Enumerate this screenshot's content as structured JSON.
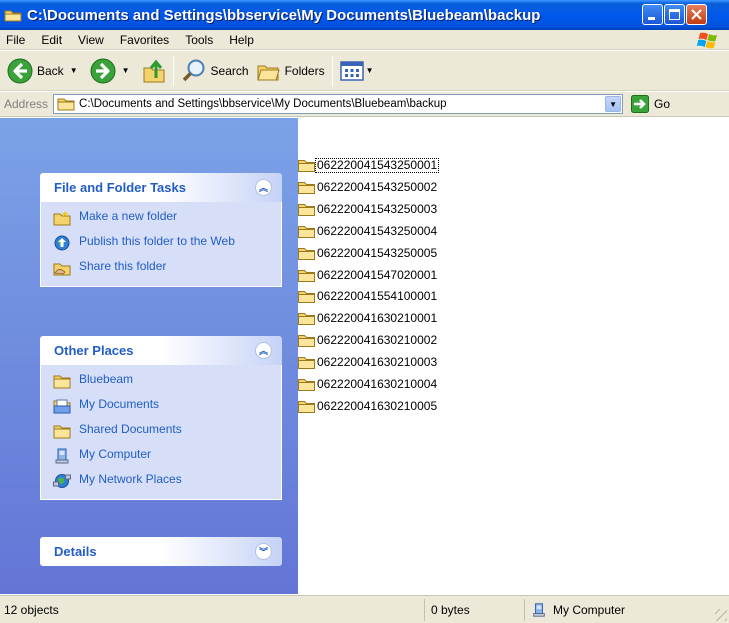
{
  "window": {
    "title": "C:\\Documents and Settings\\bbservice\\My Documents\\Bluebeam\\backup"
  },
  "menu": [
    "File",
    "Edit",
    "View",
    "Favorites",
    "Tools",
    "Help"
  ],
  "toolbar": {
    "back_label": "Back",
    "search_label": "Search",
    "folders_label": "Folders"
  },
  "address": {
    "label": "Address",
    "value": "C:\\Documents and Settings\\bbservice\\My Documents\\Bluebeam\\backup",
    "go_label": "Go"
  },
  "tasks": {
    "file_folder": {
      "title": "File and Folder Tasks",
      "items": [
        {
          "label": "Make a new folder",
          "icon": "new-folder-icon"
        },
        {
          "label": "Publish this folder to the Web",
          "icon": "publish-web-icon"
        },
        {
          "label": "Share this folder",
          "icon": "share-folder-icon"
        }
      ]
    },
    "other_places": {
      "title": "Other Places",
      "items": [
        {
          "label": "Bluebeam",
          "icon": "folder-icon"
        },
        {
          "label": "My Documents",
          "icon": "my-documents-icon"
        },
        {
          "label": "Shared Documents",
          "icon": "folder-icon"
        },
        {
          "label": "My Computer",
          "icon": "my-computer-icon"
        },
        {
          "label": "My Network Places",
          "icon": "network-places-icon"
        }
      ]
    },
    "details": {
      "title": "Details"
    }
  },
  "files": [
    "062220041543250001",
    "062220041543250002",
    "062220041543250003",
    "062220041543250004",
    "062220041543250005",
    "062220041547020001",
    "062220041554100001",
    "062220041630210001",
    "062220041630210002",
    "062220041630210003",
    "062220041630210004",
    "062220041630210005"
  ],
  "status": {
    "count": "12 objects",
    "size": "0 bytes",
    "zone": "My Computer"
  },
  "colors": {
    "titlebar": "#0058ee",
    "taskpane": "#6f8fe0",
    "link": "#215dc6",
    "folder": "#f4d36c"
  }
}
